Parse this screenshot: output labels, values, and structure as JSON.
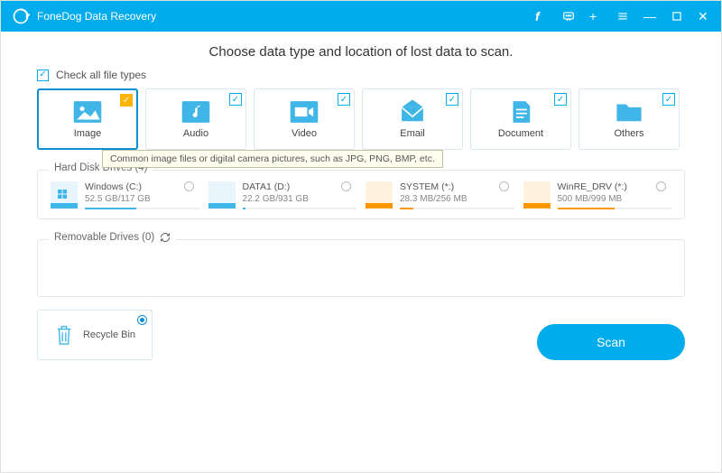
{
  "titlebar": {
    "app_name": "FoneDog Data Recovery"
  },
  "heading": "Choose data type and location of lost data to scan.",
  "check_all_label": "Check all file types",
  "types": [
    {
      "label": "Image"
    },
    {
      "label": "Audio"
    },
    {
      "label": "Video"
    },
    {
      "label": "Email"
    },
    {
      "label": "Document"
    },
    {
      "label": "Others"
    }
  ],
  "tooltip": "Common image files or digital camera pictures, such as JPG, PNG, BMP, etc.",
  "hdd": {
    "title": "Hard Disk Drives (4)",
    "drives": [
      {
        "name": "Windows (C:)",
        "size": "52.5 GB/117 GB",
        "fill": 45,
        "color": "#3fb5e8",
        "os": true
      },
      {
        "name": "DATA1 (D:)",
        "size": "22.2 GB/931 GB",
        "fill": 3,
        "color": "#3fb5e8"
      },
      {
        "name": "SYSTEM (*:)",
        "size": "28.3 MB/256 MB",
        "fill": 12,
        "color": "#ff9800"
      },
      {
        "name": "WinRE_DRV (*:)",
        "size": "500 MB/999 MB",
        "fill": 50,
        "color": "#ff9800"
      }
    ]
  },
  "removable": {
    "title": "Removable Drives (0)"
  },
  "recycle": {
    "label": "Recycle Bin"
  },
  "scan_label": "Scan"
}
